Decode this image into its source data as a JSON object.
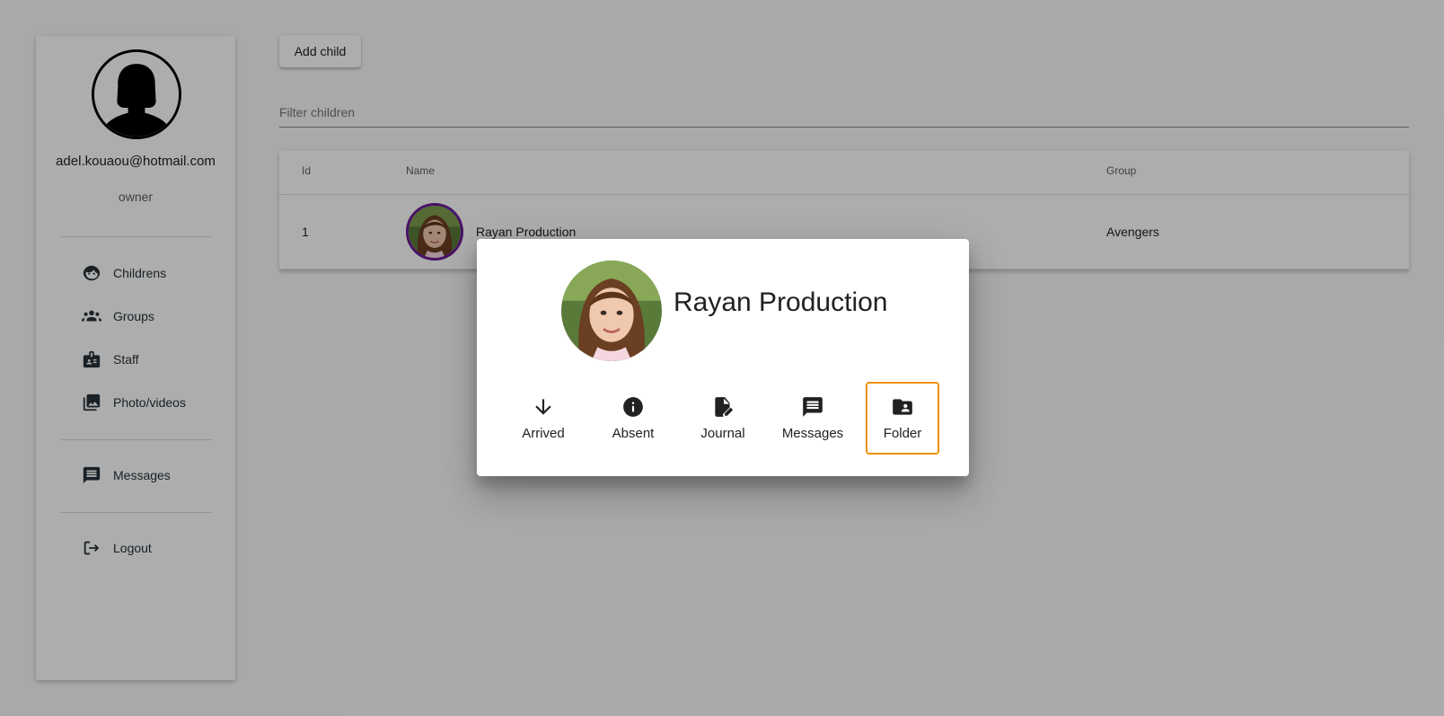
{
  "sidebar": {
    "email": "adel.kouaou@hotmail.com",
    "role": "owner",
    "nav": [
      {
        "label": "Childrens",
        "icon": "baby-face-icon"
      },
      {
        "label": "Groups",
        "icon": "groups-icon"
      },
      {
        "label": "Staff",
        "icon": "badge-icon"
      },
      {
        "label": "Photo/videos",
        "icon": "photo-library-icon"
      },
      {
        "label": "Messages",
        "icon": "message-icon"
      },
      {
        "label": "Logout",
        "icon": "logout-icon"
      }
    ]
  },
  "toolbar": {
    "add_child_label": "Add child"
  },
  "filter": {
    "placeholder": "Filter children",
    "value": ""
  },
  "table": {
    "columns": [
      "Id",
      "Name",
      "Group"
    ],
    "rows": [
      {
        "id": "1",
        "name": "Rayan Production",
        "group": "Avengers"
      }
    ]
  },
  "dialog": {
    "child_name": "Rayan Production",
    "actions": [
      {
        "label": "Arrived",
        "icon": "arrow-down-icon"
      },
      {
        "label": "Absent",
        "icon": "info-icon"
      },
      {
        "label": "Journal",
        "icon": "edit-document-icon"
      },
      {
        "label": "Messages",
        "icon": "message-icon"
      },
      {
        "label": "Folder",
        "icon": "folder-shared-icon",
        "focused": true
      }
    ]
  },
  "colors": {
    "backdrop": "rgba(0,0,0,0.32)",
    "avatar_ring": "#6a1b9a",
    "focus_ring": "#f09000"
  }
}
